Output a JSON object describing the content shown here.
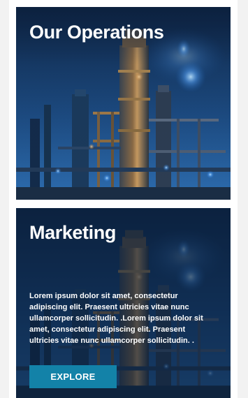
{
  "cards": [
    {
      "title": "Our Operations"
    },
    {
      "title": "Marketing",
      "body": "Lorem ipsum dolor sit amet, consectetur adipiscing elit. Praesent ultricies vitae nunc ullamcorper sollicitudin. .Lorem ipsum dolor sit amet, consectetur adipiscing elit. Praesent ultricies vitae nunc ullamcorper sollicitudin. .",
      "button_label": "EXPLORE"
    }
  ],
  "colors": {
    "page_background": "#f2f2f2",
    "column_background": "#ffffff",
    "button": "#1382a8",
    "text": "#ffffff"
  }
}
